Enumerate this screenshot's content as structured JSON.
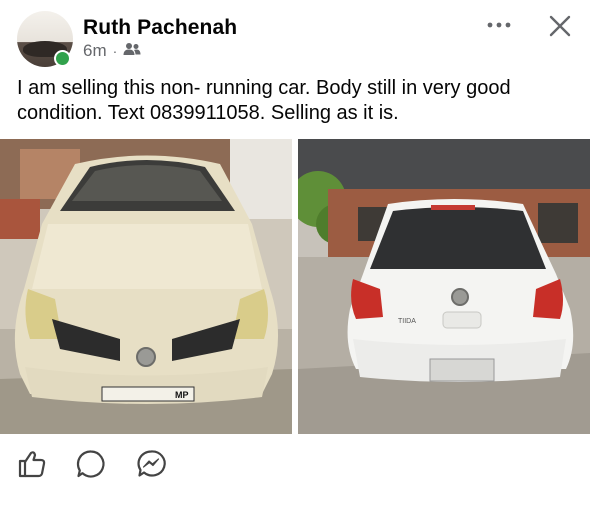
{
  "post": {
    "author": "Ruth Pachenah",
    "time": "6m",
    "audience_icon": "friends-icon",
    "text": "I am selling this non- running car. Body still in very good condition. Text 0839911058. Selling as it is."
  },
  "header_actions": {
    "more_icon": "more-options-icon",
    "close_icon": "close-icon"
  },
  "photos": [
    {
      "plate_text": "MP"
    },
    {
      "badge_text": "TIIDA"
    }
  ],
  "actions": {
    "like_icon": "like-icon",
    "comment_icon": "comment-icon",
    "share_icon": "messenger-icon"
  },
  "colors": {
    "online": "#31a24c",
    "secondary_text": "#65676b",
    "text": "#050505"
  }
}
